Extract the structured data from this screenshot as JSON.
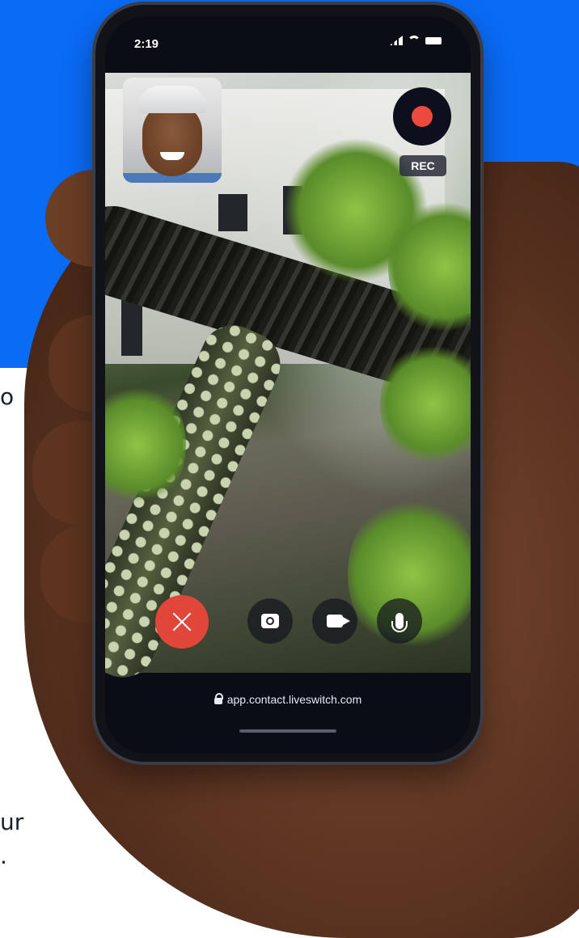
{
  "side_text": {
    "line1": "o",
    "line2": "ur",
    "line3": "."
  },
  "phone": {
    "status_bar": {
      "time": "2:19",
      "icons": [
        "signal-icon",
        "wifi-icon",
        "battery-icon"
      ]
    },
    "recording": {
      "label": "REC",
      "dot_color": "#ec4a3c"
    },
    "controls": [
      {
        "name": "end-call-button",
        "icon": "close-icon",
        "color": "#e2463a"
      },
      {
        "name": "flip-camera-button",
        "icon": "camera-flip-icon"
      },
      {
        "name": "video-toggle-button",
        "icon": "video-camera-icon"
      },
      {
        "name": "mic-toggle-button",
        "icon": "microphone-icon"
      }
    ],
    "url": "app.contact.liveswitch.com"
  },
  "colors": {
    "brand_blue": "#0a6bf5",
    "phone_frame": "#111319"
  }
}
